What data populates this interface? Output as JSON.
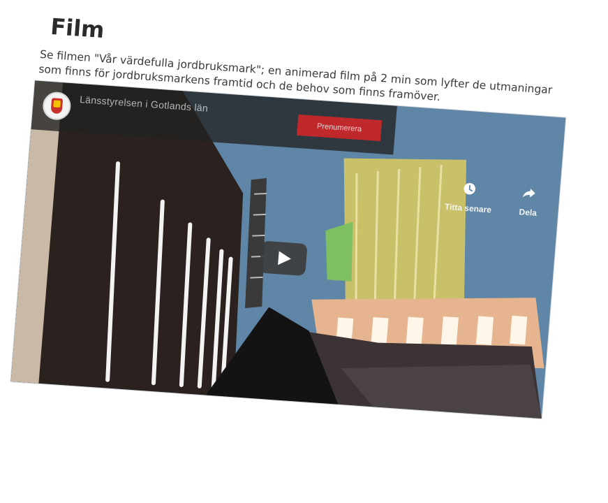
{
  "section": {
    "title": "Film",
    "description": "Se filmen \"Vår värdefulla jordbruksmark\"; en animerad film på 2 min som lyfter de utmaningar som finns för jordbruksmarkens framtid och de behov som finns framöver."
  },
  "video": {
    "channel_title": "Länsstyrelsen i Gotlands län",
    "channel_subtitle": "",
    "subscribe_label": "Prenumerera",
    "watch_later_label": "Titta senare",
    "share_label": "Dela",
    "icons": {
      "watch_later": "clock-icon",
      "share": "share-arrow-icon",
      "play": "play-icon",
      "channel": "coat-of-arms-logo"
    },
    "colors": {
      "sky": "#5f86a6",
      "subscribe": "#c8292b",
      "building_dark": "#2b221f",
      "building_yellow": "#c9c06a",
      "building_peach": "#e6b58f"
    }
  }
}
